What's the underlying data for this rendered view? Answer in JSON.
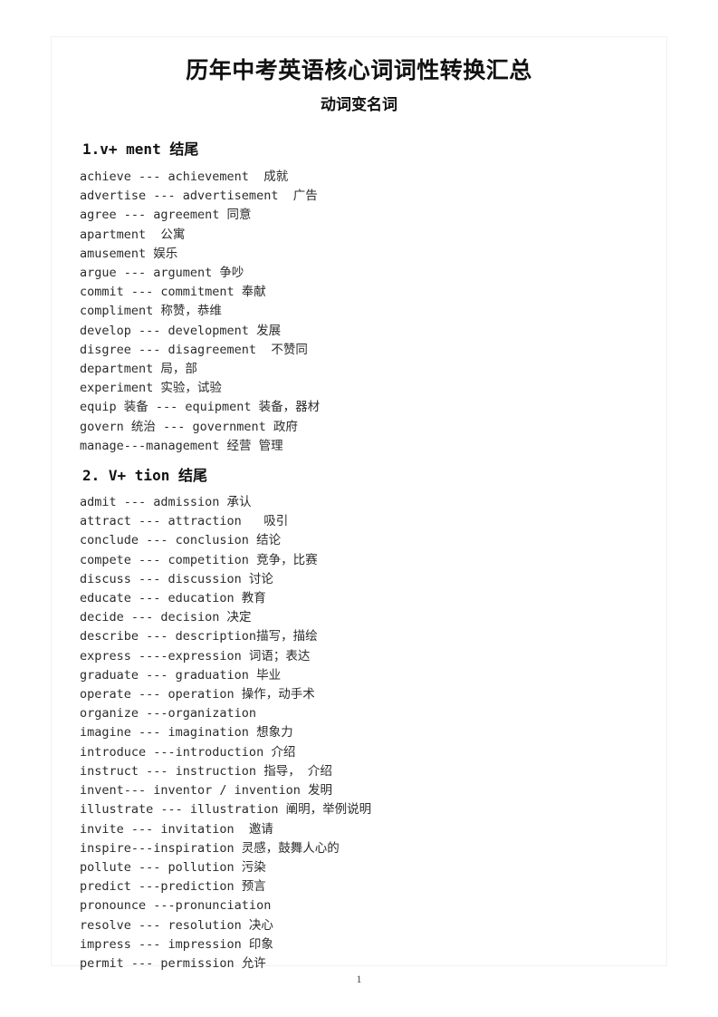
{
  "document": {
    "title": "历年中考英语核心词词性转换汇总",
    "subtitle": "动词变名词",
    "page_number": "1"
  },
  "sections": [
    {
      "heading": "1.v+ ment 结尾",
      "entries": [
        "achieve --- achievement  成就",
        "advertise --- advertisement  广告",
        "agree --- agreement 同意",
        "apartment  公寓",
        "amusement 娱乐",
        "argue --- argument 争吵",
        "commit --- commitment 奉献",
        "compliment 称赞，恭维",
        "develop --- development 发展",
        "disgree --- disagreement  不赞同",
        "department 局，部",
        "experiment 实验，试验",
        "equip 装备 --- equipment 装备，器材",
        "govern 统治 --- government 政府",
        "manage---management 经营 管理"
      ]
    },
    {
      "heading": "2. V+ tion 结尾",
      "entries": [
        "admit --- admission 承认",
        "attract --- attraction   吸引",
        "conclude --- conclusion 结论",
        "compete --- competition 竞争，比赛",
        "discuss --- discussion 讨论",
        "educate --- education 教育",
        "decide --- decision 决定",
        "describe --- description描写，描绘",
        "express ----expression 词语；表达",
        "graduate --- graduation 毕业",
        "operate --- operation 操作，动手术",
        "organize ---organization",
        "imagine --- imagination 想象力",
        "introduce ---introduction 介绍",
        "instruct --- instruction 指导， 介绍",
        "invent--- inventor / invention 发明",
        "illustrate --- illustration 阐明，举例说明",
        "invite --- invitation  邀请",
        "inspire---inspiration 灵感，鼓舞人心的",
        "pollute --- pollution 污染",
        "predict ---prediction 预言",
        "pronounce ---pronunciation",
        "resolve --- resolution 决心",
        "impress --- impression 印象",
        "permit --- permission 允许"
      ]
    }
  ]
}
